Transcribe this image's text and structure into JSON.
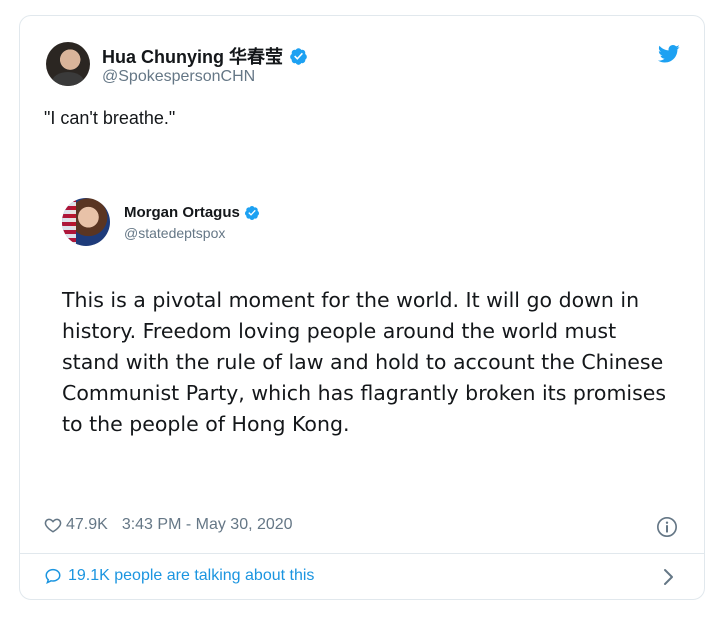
{
  "tweet": {
    "author_name": "Hua Chunying 华春莹",
    "author_handle": "@SpokespersonCHN",
    "text": "\"I can't breathe.\"",
    "likes": "47.9K",
    "timestamp": "3:43 PM - May 30, 2020",
    "conversation": "19.1K people are talking about this"
  },
  "quoted_tweet": {
    "author_name": "Morgan Ortagus",
    "author_handle": "@statedeptspox",
    "text": "This is a pivotal moment for the world. It will go down in history. Freedom loving people around the world must stand with the rule of law and hold to account the Chinese Communist Party, which has flagrantly broken its promises to the people of Hong Kong."
  },
  "icons": {
    "brand": "twitter-bird-icon",
    "verified": "verified-badge-icon",
    "like": "heart-icon",
    "info": "info-icon",
    "reply": "speech-bubble-icon",
    "more": "chevron-right-icon"
  },
  "colors": {
    "twitter_blue": "#1da1f2",
    "link_blue": "#1b95e0",
    "text_primary": "#14171a",
    "text_secondary": "#657786",
    "border": "#e1e8ed"
  }
}
